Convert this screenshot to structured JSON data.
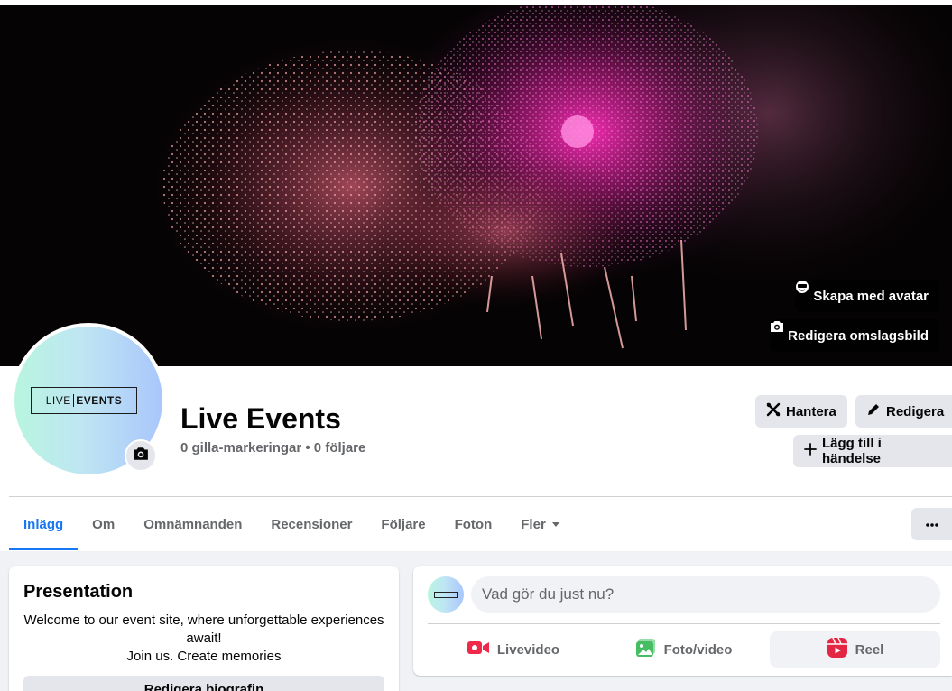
{
  "cover": {
    "avatar_button": "Skapa med avatar",
    "edit_cover_button": "Redigera omslagsbild"
  },
  "profile": {
    "logo_text_light": "LIVE",
    "logo_text_bold": "EVENTS",
    "name": "Live Events",
    "stats": "0 gilla-markeringar • 0 följare"
  },
  "actions": {
    "manage": "Hantera",
    "edit": "Redigera",
    "add_to_event": "Lägg till i händelse"
  },
  "tabs": [
    {
      "label": "Inlägg",
      "active": true
    },
    {
      "label": "Om"
    },
    {
      "label": "Omnämnanden"
    },
    {
      "label": "Recensioner"
    },
    {
      "label": "Följare"
    },
    {
      "label": "Foton"
    },
    {
      "label": "Fler"
    }
  ],
  "intro": {
    "title": "Presentation",
    "line1": "Welcome to our event site, where unforgettable experiences await!",
    "line2": "Join us. Create memories",
    "edit_bio_button": "Redigera biografin"
  },
  "composer": {
    "placeholder": "Vad gör du just nu?",
    "live_video": "Livevideo",
    "photo_video": "Foto/video",
    "reel": "Reel"
  },
  "colors": {
    "accent": "#1877f2",
    "live_icon": "#f02849",
    "photo_icon": "#45bd62",
    "reel_icon": "#e42645"
  }
}
